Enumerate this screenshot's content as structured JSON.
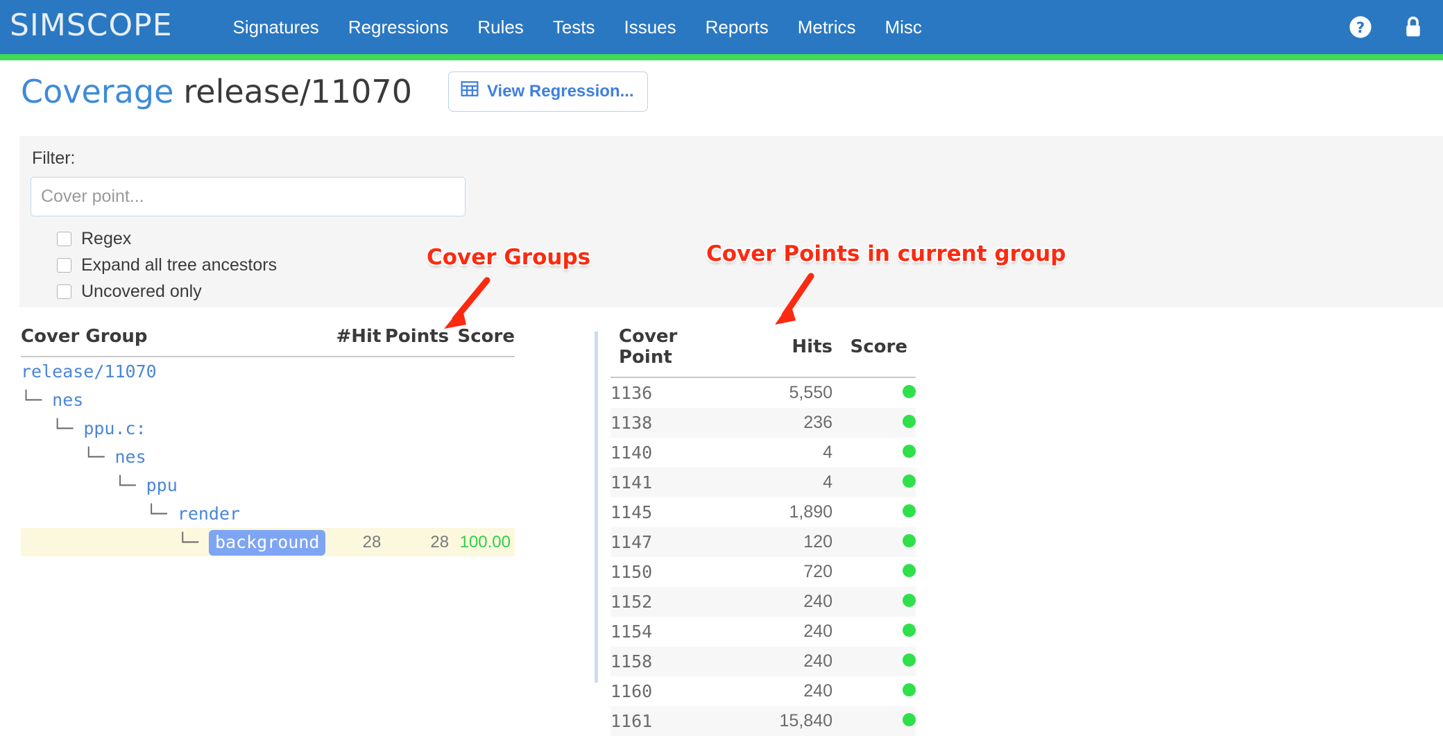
{
  "nav": {
    "brand": "SIMSCOPE",
    "links": [
      "Signatures",
      "Regressions",
      "Rules",
      "Tests",
      "Issues",
      "Reports",
      "Metrics",
      "Misc"
    ],
    "help_icon": "help-circle-icon",
    "lock_icon": "lock-icon"
  },
  "header": {
    "title_main": "Coverage",
    "title_sub": "release/11070",
    "button_label": "View Regression...",
    "button_icon": "table-grid-icon"
  },
  "filter": {
    "label": "Filter:",
    "placeholder": "Cover point...",
    "value": "",
    "checkboxes": [
      {
        "label": "Regex",
        "checked": false
      },
      {
        "label": "Expand all tree ancestors",
        "checked": false
      },
      {
        "label": "Uncovered only",
        "checked": false
      }
    ]
  },
  "annotations": [
    {
      "text": "Cover Groups",
      "color": "#fb2a10"
    },
    {
      "text": "Cover Points in current group",
      "color": "#fb2a10"
    }
  ],
  "cover_groups": {
    "headers": [
      "Cover Group",
      "#Hit",
      "Points",
      "Score"
    ],
    "rows": [
      {
        "branch": "",
        "name": "release/11070",
        "hit": "",
        "points": "",
        "score": "",
        "selected": false,
        "highlight": false
      },
      {
        "branch": "└─ ",
        "name": "nes",
        "hit": "",
        "points": "",
        "score": "",
        "selected": false,
        "highlight": false
      },
      {
        "branch": "   └─ ",
        "name": "ppu.c:",
        "hit": "",
        "points": "",
        "score": "",
        "selected": false,
        "highlight": false
      },
      {
        "branch": "      └─ ",
        "name": "nes",
        "hit": "",
        "points": "",
        "score": "",
        "selected": false,
        "highlight": false
      },
      {
        "branch": "         └─ ",
        "name": "ppu",
        "hit": "",
        "points": "",
        "score": "",
        "selected": false,
        "highlight": false
      },
      {
        "branch": "            └─ ",
        "name": "render",
        "hit": "",
        "points": "",
        "score": "",
        "selected": false,
        "highlight": false
      },
      {
        "branch": "               └─ ",
        "name": "background",
        "hit": "28",
        "points": "28",
        "score": "100.00",
        "selected": true,
        "highlight": true
      }
    ]
  },
  "cover_points": {
    "headers": [
      "Cover Point",
      "Hits",
      "Score"
    ],
    "rows": [
      {
        "point": "1136",
        "hits": "5,550",
        "score": "pass"
      },
      {
        "point": "1138",
        "hits": "236",
        "score": "pass"
      },
      {
        "point": "1140",
        "hits": "4",
        "score": "pass"
      },
      {
        "point": "1141",
        "hits": "4",
        "score": "pass"
      },
      {
        "point": "1145",
        "hits": "1,890",
        "score": "pass"
      },
      {
        "point": "1147",
        "hits": "120",
        "score": "pass"
      },
      {
        "point": "1150",
        "hits": "720",
        "score": "pass"
      },
      {
        "point": "1152",
        "hits": "240",
        "score": "pass"
      },
      {
        "point": "1154",
        "hits": "240",
        "score": "pass"
      },
      {
        "point": "1158",
        "hits": "240",
        "score": "pass"
      },
      {
        "point": "1160",
        "hits": "240",
        "score": "pass"
      },
      {
        "point": "1161",
        "hits": "15,840",
        "score": "pass"
      }
    ]
  },
  "colors": {
    "nav_blue": "#2a78c2",
    "accent_green": "#40d958",
    "link_blue": "#4a86d8",
    "score_green": "#2fd04a",
    "selection_blue": "#7ea5f4",
    "highlight_yellow": "#fcf8de",
    "annotation_red": "#fb2a10"
  }
}
